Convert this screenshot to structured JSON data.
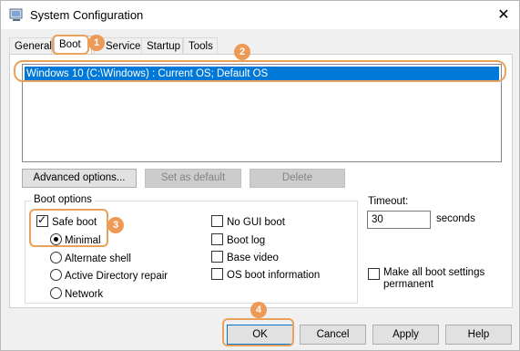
{
  "window": {
    "title": "System Configuration",
    "close_glyph": "✕"
  },
  "tabs": [
    {
      "label": "General"
    },
    {
      "label": "Boot"
    },
    {
      "label": "Services"
    },
    {
      "label": "Startup"
    },
    {
      "label": "Tools"
    }
  ],
  "boot": {
    "os_entries": [
      "Windows 10 (C:\\Windows) : Current OS; Default OS"
    ],
    "advanced_label": "Advanced options...",
    "set_default_label": "Set as default",
    "delete_label": "Delete",
    "boot_options_label": "Boot options",
    "safe_boot_label": "Safe boot",
    "minimal_label": "Minimal",
    "alternate_shell_label": "Alternate shell",
    "active_directory_label": "Active Directory repair",
    "network_label": "Network",
    "no_gui_label": "No GUI boot",
    "boot_log_label": "Boot log",
    "base_video_label": "Base video",
    "os_boot_info_label": "OS boot information",
    "timeout_label": "Timeout:",
    "timeout_value": "30",
    "seconds_label": "seconds",
    "make_permanent_label": "Make all boot settings permanent"
  },
  "footer": {
    "ok_label": "OK",
    "cancel_label": "Cancel",
    "apply_label": "Apply",
    "help_label": "Help"
  },
  "annotations": {
    "m1": "1",
    "m2": "2",
    "m3": "3",
    "m4": "4",
    "color": "#ee9a57"
  },
  "colors": {
    "selection": "#0078d7",
    "highlight_border": "#e8a25c"
  }
}
